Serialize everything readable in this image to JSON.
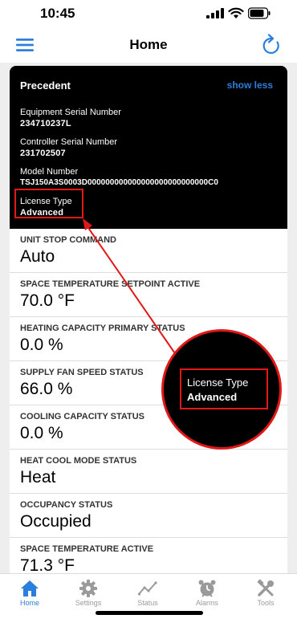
{
  "status_bar": {
    "time": "10:45"
  },
  "nav": {
    "title": "Home"
  },
  "header": {
    "equipment_name": "Precedent",
    "toggle_label": "show less",
    "fields": [
      {
        "label": "Equipment Serial Number",
        "value": "234710237L"
      },
      {
        "label": "Controller Serial Number",
        "value": "231702507"
      },
      {
        "label": "Model Number",
        "value": "TSJ150A3S0003D000000000000000000000000000C0"
      },
      {
        "label": "License Type",
        "value": "Advanced"
      }
    ]
  },
  "rows": [
    {
      "label": "UNIT STOP COMMAND",
      "value": "Auto"
    },
    {
      "label": "SPACE TEMPERATURE SETPOINT ACTIVE",
      "value": "70.0 °F"
    },
    {
      "label": "HEATING CAPACITY PRIMARY STATUS",
      "value": "0.0 %"
    },
    {
      "label": "SUPPLY FAN SPEED STATUS",
      "value": "66.0 %"
    },
    {
      "label": "COOLING CAPACITY STATUS",
      "value": "0.0 %"
    },
    {
      "label": "HEAT COOL MODE STATUS",
      "value": "Heat"
    },
    {
      "label": "OCCUPANCY STATUS",
      "value": "Occupied"
    },
    {
      "label": "SPACE TEMPERATURE ACTIVE",
      "value": "71.3 °F"
    }
  ],
  "callout": {
    "label": "License Type",
    "value": "Advanced"
  },
  "tabs": [
    {
      "label": "Home",
      "icon": "home-icon",
      "active": true
    },
    {
      "label": "Settings",
      "icon": "gear-icon",
      "active": false
    },
    {
      "label": "Status",
      "icon": "trend-icon",
      "active": false
    },
    {
      "label": "Alarms",
      "icon": "alarm-clock-icon",
      "active": false
    },
    {
      "label": "Tools",
      "icon": "tools-icon",
      "active": false
    }
  ],
  "colors": {
    "accent": "#2a7fdc",
    "highlight": "#e01818",
    "header_bg": "#000000",
    "inactive_tab": "#9a9a9a"
  }
}
